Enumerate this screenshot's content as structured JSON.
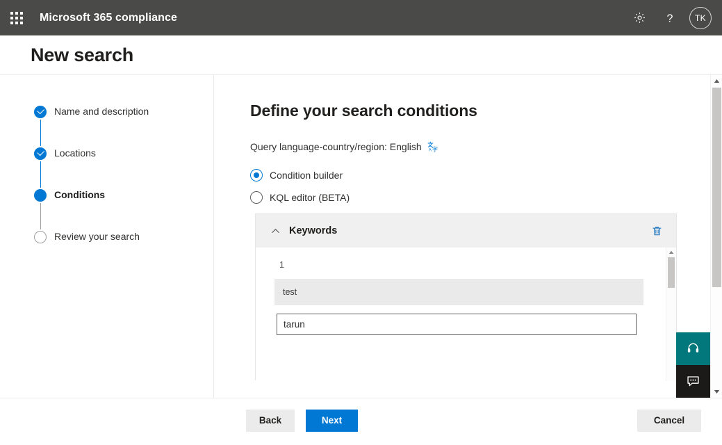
{
  "suite_header": {
    "waffle_icon": "app-launcher-waffle-icon",
    "title": "Microsoft 365 compliance",
    "settings_icon": "gear-icon",
    "help_icon": "question-mark-icon",
    "avatar_initials": "TK",
    "background_color": "#4a4a48"
  },
  "page": {
    "title": "New search"
  },
  "wizard": {
    "steps": [
      {
        "label": "Name and description",
        "state": "completed"
      },
      {
        "label": "Locations",
        "state": "completed"
      },
      {
        "label": "Conditions",
        "state": "current"
      },
      {
        "label": "Review your search",
        "state": "pending"
      }
    ]
  },
  "content": {
    "heading": "Define your search conditions",
    "query_language_label": "Query language-country/region: English",
    "language_icon": "translate-language-icon",
    "options": [
      {
        "label": "Condition builder",
        "selected": true
      },
      {
        "label": "KQL editor (BETA)",
        "selected": false
      }
    ],
    "keywords_card": {
      "collapse_icon": "chevron-up-icon",
      "title": "Keywords",
      "delete_icon": "trash-icon",
      "row_number": "1",
      "existing_keyword": "test",
      "input_value": "tarun",
      "input_placeholder": ""
    }
  },
  "side_widgets": [
    {
      "name": "support-headset-widget",
      "icon": "headset-icon",
      "color": "#03787c"
    },
    {
      "name": "feedback-chat-widget",
      "icon": "chat-bubble-icon",
      "color": "#1b1a19"
    }
  ],
  "footer": {
    "back_label": "Back",
    "next_label": "Next",
    "cancel_label": "Cancel",
    "primary_color": "#0078d4"
  }
}
